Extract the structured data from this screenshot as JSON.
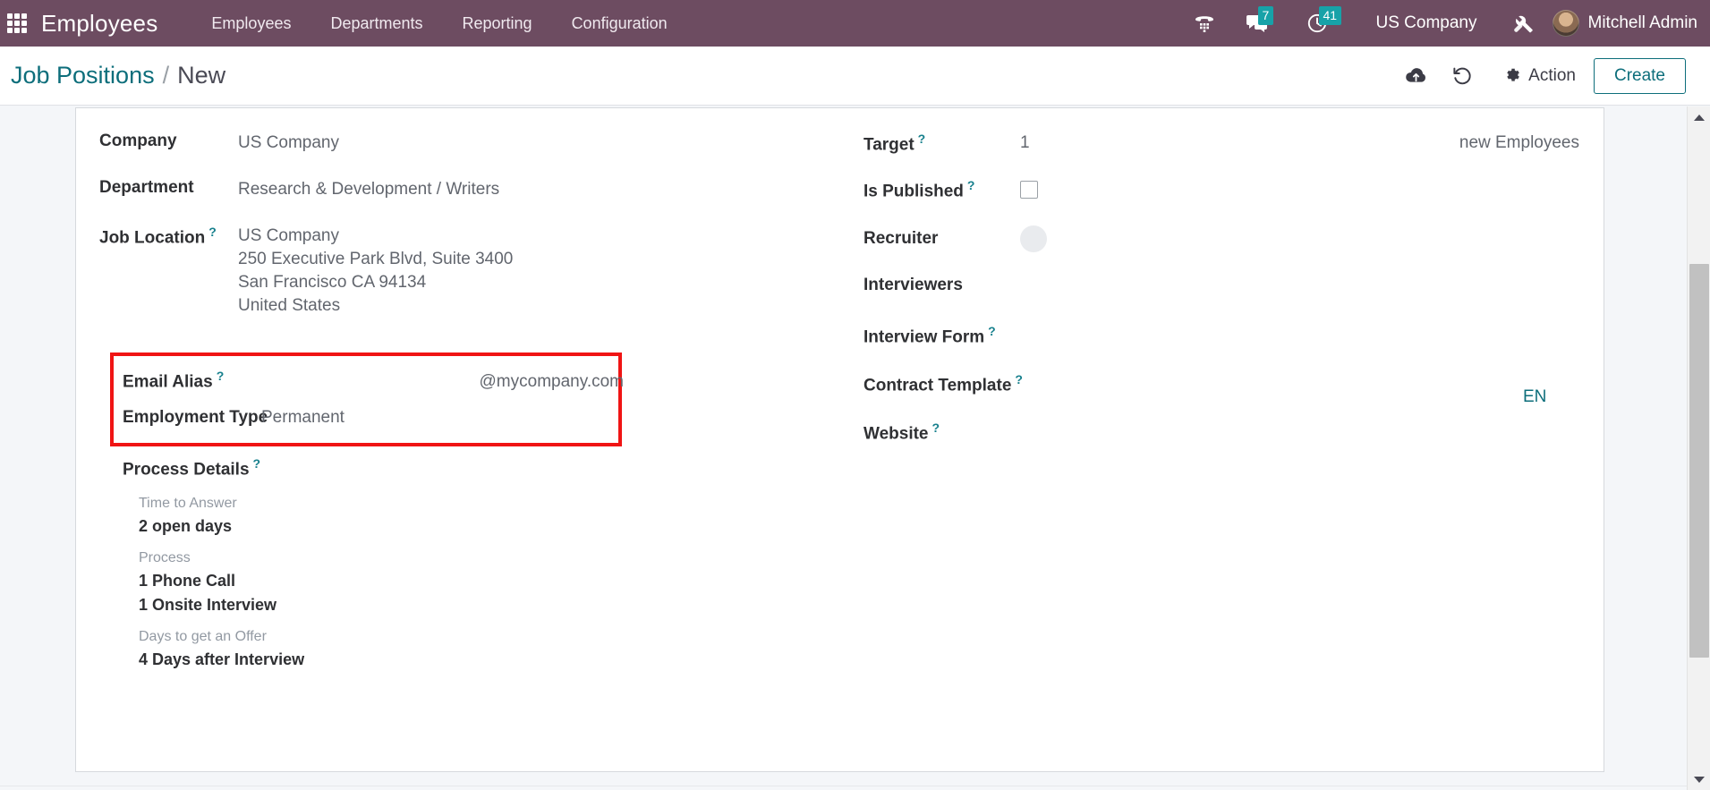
{
  "navbar": {
    "apps_icon": "apps-grid-icon",
    "brand": "Employees",
    "menu": [
      {
        "label": "Employees"
      },
      {
        "label": "Departments"
      },
      {
        "label": "Reporting"
      },
      {
        "label": "Configuration"
      }
    ],
    "systray": {
      "voip_icon": "phone-dialpad-icon",
      "messages_icon": "chat-bubbles-icon",
      "messages_count": "7",
      "activities_icon": "clock-icon",
      "activities_count": "41",
      "company": "US Company",
      "debug_icon": "tools-icon",
      "user_name": "Mitchell Admin",
      "avatar": "user-avatar"
    },
    "background_color": "#6d4c61",
    "badge_color": "#17a2a8"
  },
  "control_panel": {
    "breadcrumb_root": "Job Positions",
    "breadcrumb_separator": "/",
    "breadcrumb_current": "New",
    "save_icon": "cloud-upload-icon",
    "discard_icon": "undo-icon",
    "action_icon": "gear-icon",
    "action_label": "Action",
    "create_label": "Create",
    "accent_color": "#0d6e7b"
  },
  "form": {
    "left": {
      "company_label": "Company",
      "company_value": "US Company",
      "department_label": "Department",
      "department_value": "Research & Development / Writers",
      "job_location_label": "Job Location",
      "job_location_lines": [
        "US Company",
        "250 Executive Park Blvd, Suite 3400",
        "San Francisco CA 94134",
        "United States"
      ],
      "email_alias_label": "Email Alias",
      "email_alias_domain": "@mycompany.com",
      "employment_type_label": "Employment Type",
      "employment_type_value": "Permanent"
    },
    "process_details": {
      "title": "Process Details",
      "groups": [
        {
          "key": "Time to Answer",
          "values": [
            "2 open days"
          ]
        },
        {
          "key": "Process",
          "values": [
            "1 Phone Call",
            "1 Onsite Interview"
          ]
        },
        {
          "key": "Days to get an Offer",
          "values": [
            "4 Days after Interview"
          ]
        }
      ]
    },
    "right": {
      "target_label": "Target",
      "target_value": "1",
      "target_suffix": "new Employees",
      "is_published_label": "Is Published",
      "is_published_checked": false,
      "recruiter_label": "Recruiter",
      "interviewers_label": "Interviewers",
      "interview_form_label": "Interview Form",
      "contract_template_label": "Contract Template",
      "website_label": "Website"
    },
    "language_badge": "EN",
    "tooltip_glyph": "?",
    "highlight_color": "#f01414"
  }
}
